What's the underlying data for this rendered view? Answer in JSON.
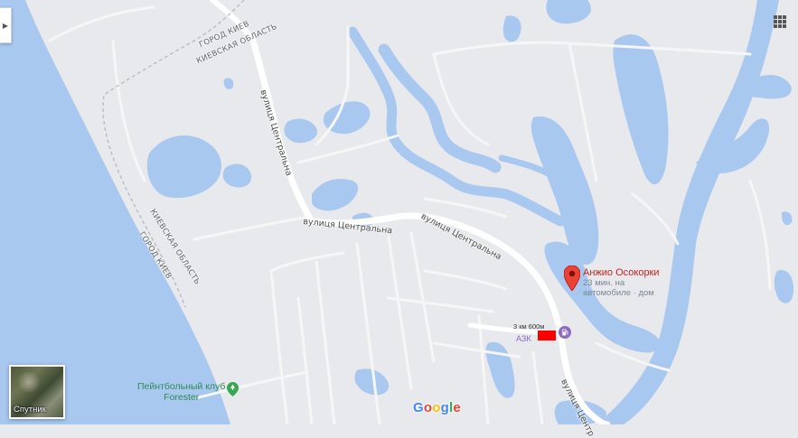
{
  "map": {
    "colors": {
      "land": "#e8e9ec",
      "water": "#a8c8f0",
      "road_major": "#ffffff",
      "road_minor": "#f6f6f6",
      "poi_red": "#c5221f",
      "park_green": "#2e8b57",
      "redaction": "#ff0000"
    },
    "region_labels": {
      "city_top": "ГОРОД КИЕВ",
      "oblast_top": "КИЕВСКАЯ ОБЛАСТЬ",
      "oblast_left": "КИЕВСКАЯ ОБЛАСТЬ",
      "city_left": "ГОРОД КИЕВ"
    },
    "road_labels": {
      "tsentralna_1": "вулиця Центральна",
      "tsentralna_2": "вулиця Центральна",
      "tsentralna_3": "вулиця Центральна",
      "tsentralna_4": "вулиця Центральна",
      "tsentralna_5": "вулиця Центр"
    },
    "destination": {
      "icon": "red-map-pin-icon",
      "name": "Анжио Осокорки",
      "travel_line1": "23 мин. на",
      "travel_line2": "автомобиле · дом"
    },
    "gas_station": {
      "icon": "gas-station-icon",
      "distance": "3 км 600м",
      "name": "АЗК"
    },
    "park": {
      "icon": "park-pin-icon",
      "line1": "Пейнтбольный клуб",
      "line2": "Forester"
    },
    "controls": {
      "side_toggle_icon": "chevron-right-icon",
      "apps_icon": "grid-icon",
      "satellite_label": "Спутник"
    },
    "logo": [
      "G",
      "o",
      "o",
      "g",
      "l",
      "e"
    ],
    "logo_colors": [
      "#4285f4",
      "#ea4335",
      "#fbbc05",
      "#4285f4",
      "#34a853",
      "#ea4335"
    ]
  }
}
